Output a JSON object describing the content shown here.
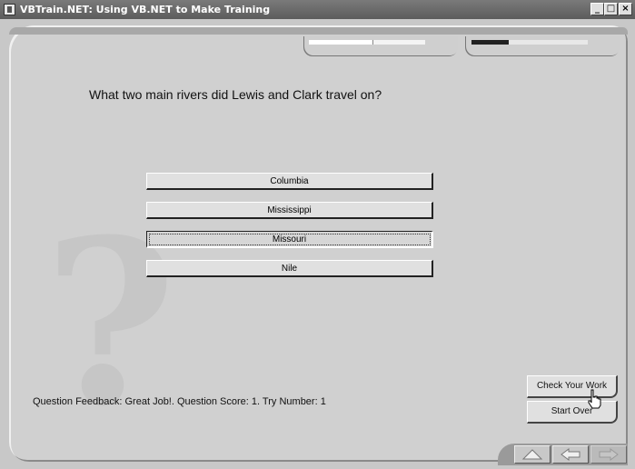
{
  "window": {
    "title": "VBTrain.NET: Using VB.NET to Make Training",
    "minimize": "_",
    "maximize": "□",
    "close": "×"
  },
  "progress": {
    "left_fraction": 0.55,
    "right_fraction": 0.32
  },
  "question": {
    "text": "What two main rivers did Lewis and  Clark travel on?",
    "answers": [
      {
        "label": "Columbia",
        "selected": false
      },
      {
        "label": "Mississippi",
        "selected": false
      },
      {
        "label": "Missouri",
        "selected": true
      },
      {
        "label": "Nile",
        "selected": false
      }
    ]
  },
  "feedback": "Question Feedback: Great Job!. Question Score: 1. Try Number: 1",
  "buttons": {
    "check": "Check Your Work",
    "start_over": "Start Over"
  },
  "nav": [
    "up-arrow-icon",
    "back-arrow-icon",
    "forward-arrow-icon"
  ]
}
